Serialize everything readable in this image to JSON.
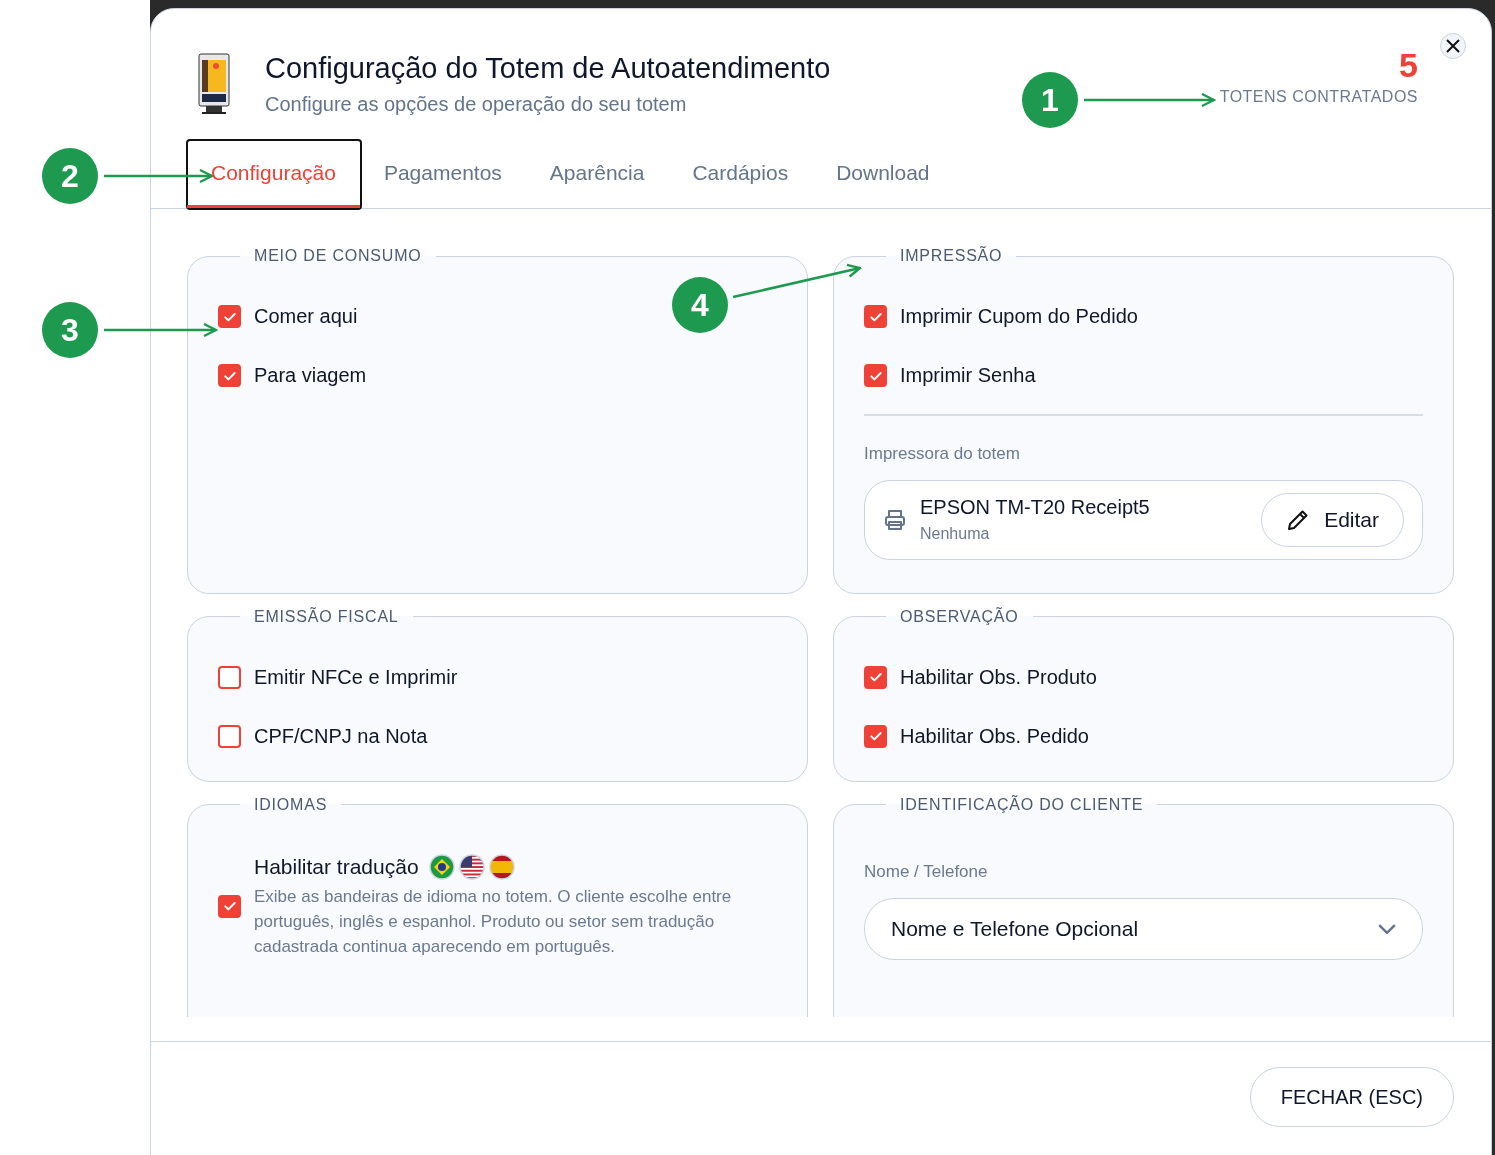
{
  "header": {
    "title": "Configuração do Totem de Autoatendimento",
    "subtitle": "Configure as opções de operação do seu totem",
    "count": "5",
    "count_label": "TOTENS CONTRATADOS"
  },
  "tabs": [
    {
      "label": "Configuração",
      "selected": true
    },
    {
      "label": "Pagamentos",
      "selected": false
    },
    {
      "label": "Aparência",
      "selected": false
    },
    {
      "label": "Cardápios",
      "selected": false
    },
    {
      "label": "Download",
      "selected": false
    }
  ],
  "sections": [
    {
      "kind": "checklist",
      "title": "MEIO DE CONSUMO",
      "options": [
        {
          "label": "Comer aqui",
          "checked": true
        },
        {
          "label": "Para viagem",
          "checked": true
        }
      ]
    },
    {
      "kind": "printing",
      "title": "IMPRESSÃO",
      "options": [
        {
          "label": "Imprimir Cupom do Pedido",
          "checked": true
        },
        {
          "label": "Imprimir Senha",
          "checked": true
        }
      ],
      "printer_label": "Impressora do totem",
      "printer_name": "EPSON TM-T20 Receipt5",
      "printer_detail": "Nenhuma",
      "edit_button": "Editar"
    },
    {
      "kind": "checklist",
      "title": "EMISSÃO FISCAL",
      "options": [
        {
          "label": "Emitir NFCe e Imprimir",
          "checked": false
        },
        {
          "label": "CPF/CNPJ na Nota",
          "checked": false
        }
      ]
    },
    {
      "kind": "checklist",
      "title": "OBSERVAÇÃO",
      "options": [
        {
          "label": "Habilitar Obs. Produto",
          "checked": true
        },
        {
          "label": "Habilitar Obs. Pedido",
          "checked": true
        }
      ]
    },
    {
      "kind": "languages",
      "title": "IDIOMAS",
      "label": "Habilitar tradução",
      "checked": true,
      "description": "Exibe as bandeiras de idioma no totem. O cliente escolhe entre português, inglês e espanhol. Produto ou setor sem tradução cadastrada continua aparecendo em português."
    },
    {
      "kind": "select",
      "title": "IDENTIFICAÇÃO DO CLIENTE",
      "field_label": "Nome / Telefone",
      "value": "Nome e Telefone Opcional"
    }
  ],
  "footer": {
    "close_button": "FECHAR (ESC)"
  },
  "annotations": [
    {
      "number": "1",
      "highlight": false
    },
    {
      "number": "2",
      "highlight": true
    },
    {
      "number": "3",
      "highlight": false
    },
    {
      "number": "4",
      "highlight": false
    }
  ]
}
